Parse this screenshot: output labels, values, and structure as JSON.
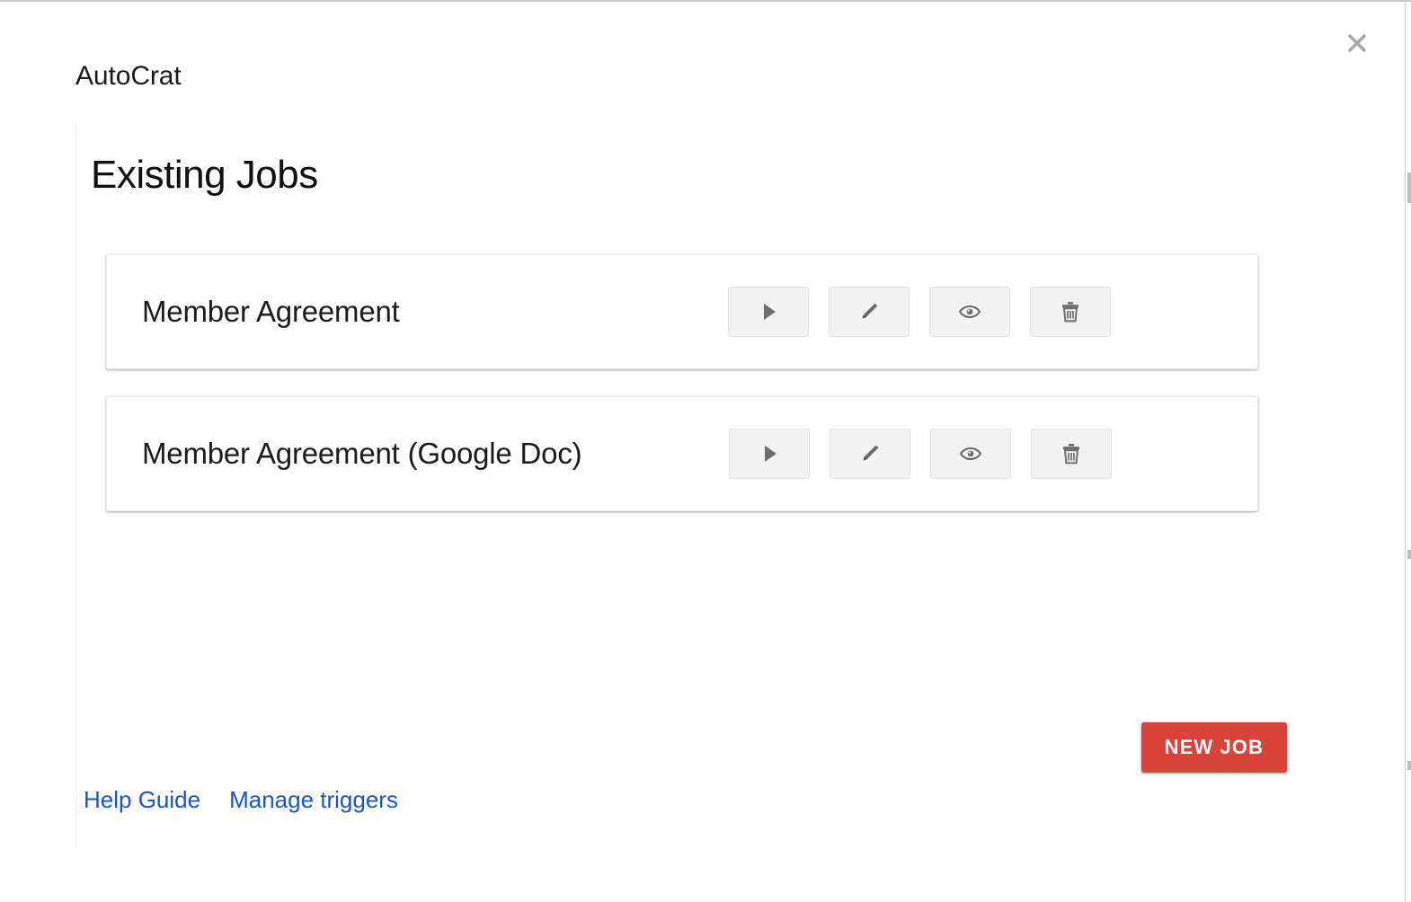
{
  "window": {
    "app_title": "AutoCrat",
    "close_icon": "close-icon"
  },
  "main": {
    "heading": "Existing Jobs"
  },
  "jobs": [
    {
      "name": "Member Agreement",
      "actions": [
        {
          "icon": "play-icon",
          "label": "Run job"
        },
        {
          "icon": "pencil-icon",
          "label": "Edit job"
        },
        {
          "icon": "eye-icon",
          "label": "Preview job"
        },
        {
          "icon": "trash-icon",
          "label": "Delete job"
        }
      ]
    },
    {
      "name": "Member Agreement (Google Doc)",
      "actions": [
        {
          "icon": "play-icon",
          "label": "Run job"
        },
        {
          "icon": "pencil-icon",
          "label": "Edit job"
        },
        {
          "icon": "eye-icon",
          "label": "Preview job"
        },
        {
          "icon": "trash-icon",
          "label": "Delete job"
        }
      ]
    }
  ],
  "footer": {
    "help_guide_label": "Help Guide",
    "manage_triggers_label": "Manage triggers",
    "new_job_label": "NEW JOB"
  },
  "colors": {
    "accent_red": "#d9453b",
    "link_blue": "#1a56c4",
    "icon_gray": "#757575",
    "button_face": "#f3f3f3"
  }
}
